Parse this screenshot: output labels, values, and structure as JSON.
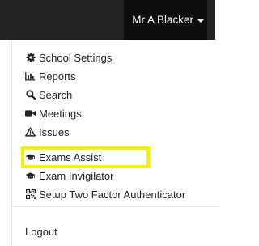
{
  "navbar": {
    "user_name": "Mr A Blacker"
  },
  "menu": {
    "items": [
      {
        "label": "School Settings",
        "icon": "gear-icon"
      },
      {
        "label": "Reports",
        "icon": "bar-chart-icon"
      },
      {
        "label": "Search",
        "icon": "search-icon"
      },
      {
        "label": "Meetings",
        "icon": "video-camera-icon"
      },
      {
        "label": "Issues",
        "icon": "warning-triangle-icon"
      },
      {
        "label": "Exams Assist",
        "icon": "graduation-cap-icon"
      },
      {
        "label": "Exam Invigilator",
        "icon": "graduation-cap-icon"
      },
      {
        "label": "Setup Two Factor Authenticator",
        "icon": "qr-code-icon"
      }
    ],
    "logout_label": "Logout"
  },
  "highlight": {
    "target": "Exams Assist",
    "color": "#f4f000"
  }
}
